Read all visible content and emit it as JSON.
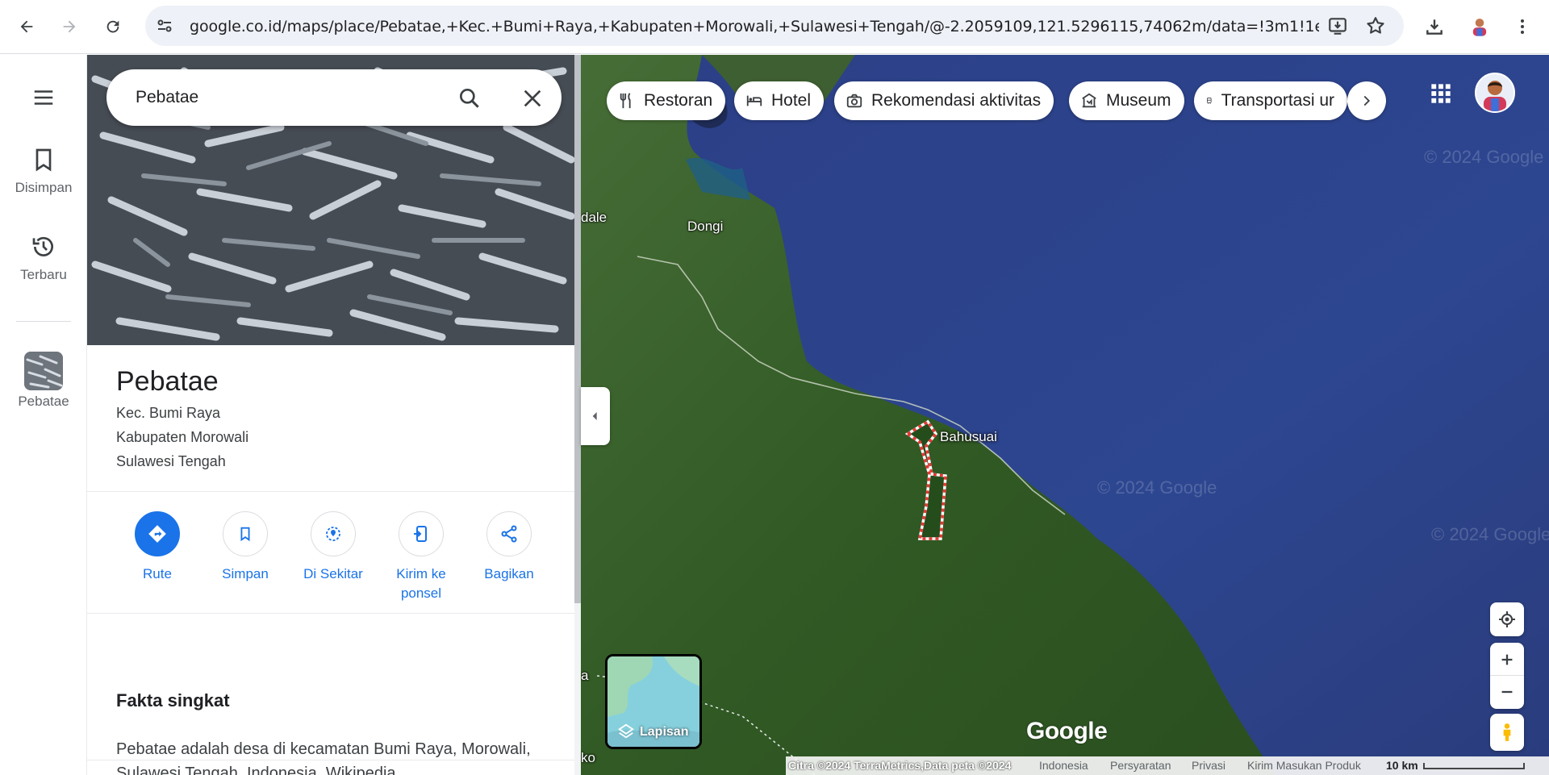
{
  "browser": {
    "url": "google.co.id/maps/place/Pebatae,+Kec.+Bumi+Raya,+Kabupaten+Morowali,+Sulawesi+Tengah/@-2.2059109,121.5296115,74062m/data=!3m1!1e3!..."
  },
  "rail": {
    "saved_label": "Disimpan",
    "recent_label": "Terbaru",
    "place_label": "Pebatae"
  },
  "search": {
    "query": "Pebatae"
  },
  "place": {
    "name": "Pebatae",
    "address_line1": "Kec. Bumi Raya",
    "address_line2": "Kabupaten Morowali",
    "address_line3": "Sulawesi Tengah"
  },
  "actions": [
    {
      "label": "Rute"
    },
    {
      "label": "Simpan"
    },
    {
      "label": "Di Sekitar"
    },
    {
      "label": "Kirim ke ponsel"
    },
    {
      "label": "Bagikan"
    }
  ],
  "facts": {
    "heading": "Fakta singkat",
    "text": "Pebatae adalah desa di kecamatan Bumi Raya, Morowali, Sulawesi Tengah, Indonesia.",
    "link": "Wikipedia"
  },
  "chips": [
    {
      "label": "Restoran"
    },
    {
      "label": "Hotel"
    },
    {
      "label": "Rekomendasi aktivitas"
    },
    {
      "label": "Museum"
    },
    {
      "label": "Transportasi ur"
    }
  ],
  "map": {
    "labels": {
      "dale": "dale",
      "dongi": "Dongi",
      "bahusuai": "Bahusuai",
      "a": "a",
      "ko": "ko"
    },
    "layers_label": "Lapisan",
    "logo": "Google",
    "watermark": "© 2024 Google"
  },
  "footer": {
    "imagery": "Citra ©2024 TerraMetrics,Data peta ©2024",
    "country": "Indonesia",
    "terms": "Persyaratan",
    "privacy": "Privasi",
    "feedback": "Kirim Masukan Produk",
    "scale": "10 km"
  },
  "colors": {
    "accent": "#1a73e8",
    "boundary": "#e53935"
  }
}
